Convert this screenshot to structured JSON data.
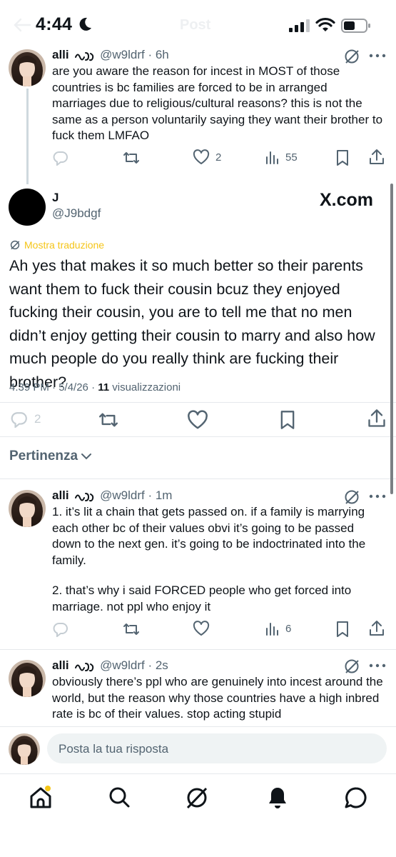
{
  "status_bar": {
    "time": "4:44"
  },
  "header": {
    "title": "Post"
  },
  "parent_tweet": {
    "name": "alli",
    "handle": "@w9ldrf",
    "time": "6h",
    "text": "are you aware the reason for incest in MOST of those countries is bc families are forced to be in arranged marriages due to religious/cultural reasons? this is not the same as a person voluntarily saying they want their brother to fuck them LMFAO",
    "likes": "2",
    "views": "55"
  },
  "main_tweet": {
    "name": "J",
    "handle": "@J9bdgf",
    "watermark": "X.com",
    "translate_label": "Mostra traduzione",
    "text": "Ah yes that makes it so much better so their parents want them to fuck their cousin bcuz they enjoyed fucking their cousin, you are to tell me that no men didn’t enjoy getting their cousin to marry and also how much people do you really think are fucking their brother?",
    "timestamp": "4:39 PM · 5/4/26 · ",
    "views_count": "11",
    "views_label": " visualizzazioni",
    "replies": "2"
  },
  "sort": {
    "label": "Pertinenza"
  },
  "replies": [
    {
      "name": "alli",
      "handle": "@w9ldrf",
      "time": "1m",
      "text1": "1. it’s lit a chain that gets passed on. if a family is marrying each other bc of their values obvi it’s going to be passed down to the next gen. it’s going to be indoctrinated into the family.",
      "text2": "2. that’s why i said FORCED people who get forced into marriage. not ppl who enjoy it",
      "views": "6"
    },
    {
      "name": "alli",
      "handle": "@w9ldrf",
      "time": "2s",
      "text1": "obviously there’s ppl who are genuinely into incest around the world, but the reason why those countries have a high inbred rate is bc of their values. stop acting stupid"
    }
  ],
  "reply_bar": {
    "placeholder": "Posta la tua risposta"
  },
  "colors": {
    "translate": "#f5c518",
    "notification_dot": "#f5c518",
    "secondary_text": "#536471"
  }
}
